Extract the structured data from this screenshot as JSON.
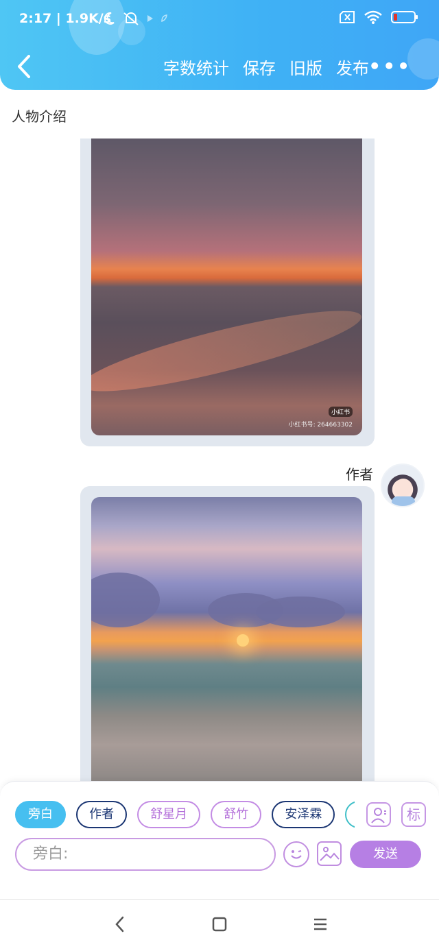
{
  "status_bar": {
    "time_speed": "2:17 | 1.9K/s"
  },
  "header": {
    "actions": [
      "字数统计",
      "保存",
      "旧版",
      "发布"
    ],
    "more": "•••"
  },
  "chat": {
    "section_title": "人物介绍",
    "image1_tag": "小红书",
    "image1_watermark": "小红书号: 264663302",
    "speaker": "作者"
  },
  "bottom": {
    "chips": [
      {
        "label": "旁白"
      },
      {
        "label": "作者"
      },
      {
        "label": "舒星月"
      },
      {
        "label": "舒竹"
      },
      {
        "label": "安泽霖"
      },
      {
        "label": ""
      }
    ],
    "tag_button": "标",
    "input_placeholder": "旁白:",
    "send_label": "发送"
  },
  "colors": {
    "header_bg": "#3fb1f5",
    "active_chip": "#46bff0",
    "navy_chip": "#1b3673",
    "purple_accent": "#c38ce4",
    "send_button": "#b67fe4"
  }
}
